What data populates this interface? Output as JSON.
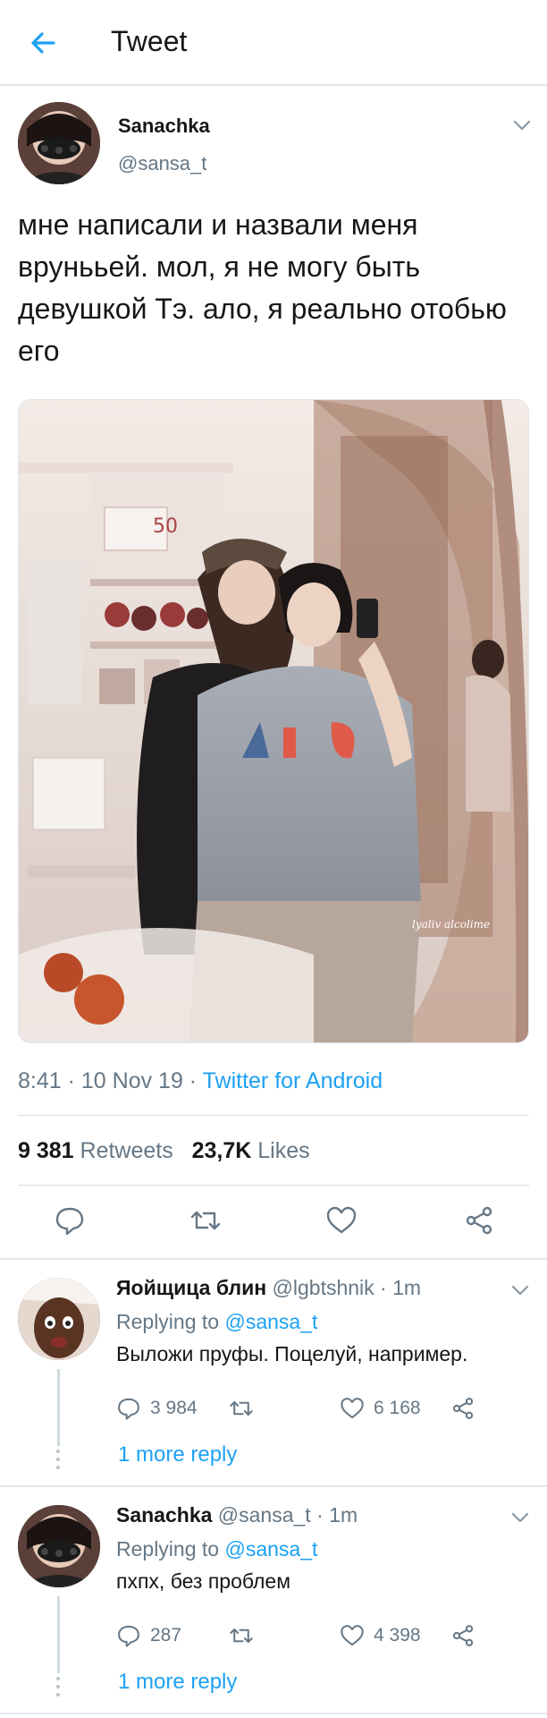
{
  "header": {
    "title": "Tweet",
    "back_icon": "arrow-left-icon"
  },
  "tweet": {
    "author_name": "Sanachka",
    "author_handle": "@sansa_t",
    "text": "мне написали и назвали меня врунььей. мол, я не могу быть девушкой Тэ. ало, я реально отобью его",
    "time": "8:41",
    "sep1": " · ",
    "date": "10 Nov 19",
    "sep2": " · ",
    "source": "Twitter for Android",
    "retweets_count": "9 381",
    "retweets_label": "Retweets",
    "likes_count": "23,7K",
    "likes_label": "Likes",
    "image_signature": "lyaliv alcolime",
    "image_sign_text": "50"
  },
  "replies": [
    {
      "name": "Яойщица блин",
      "handle": "@lgbtshnik",
      "sep": " · ",
      "time": "1m",
      "replying_label": "Replying to ",
      "replying_to": "@sansa_t",
      "text": "Выложи пруфы. Поцелуй, например.",
      "reply_count": "3 984",
      "like_count": "6 168",
      "more": "1 more reply"
    },
    {
      "name": "Sanachka",
      "handle": "@sansa_t",
      "sep": " · ",
      "time": "1m",
      "replying_label": "Replying to ",
      "replying_to": "@sansa_t",
      "text": "пхпх, без проблем",
      "reply_count": "287",
      "like_count": "4 398",
      "more": "1 more reply"
    }
  ],
  "colors": {
    "accent": "#1da1f2",
    "secondary_text": "#657786",
    "divider": "#e1e8ed"
  }
}
